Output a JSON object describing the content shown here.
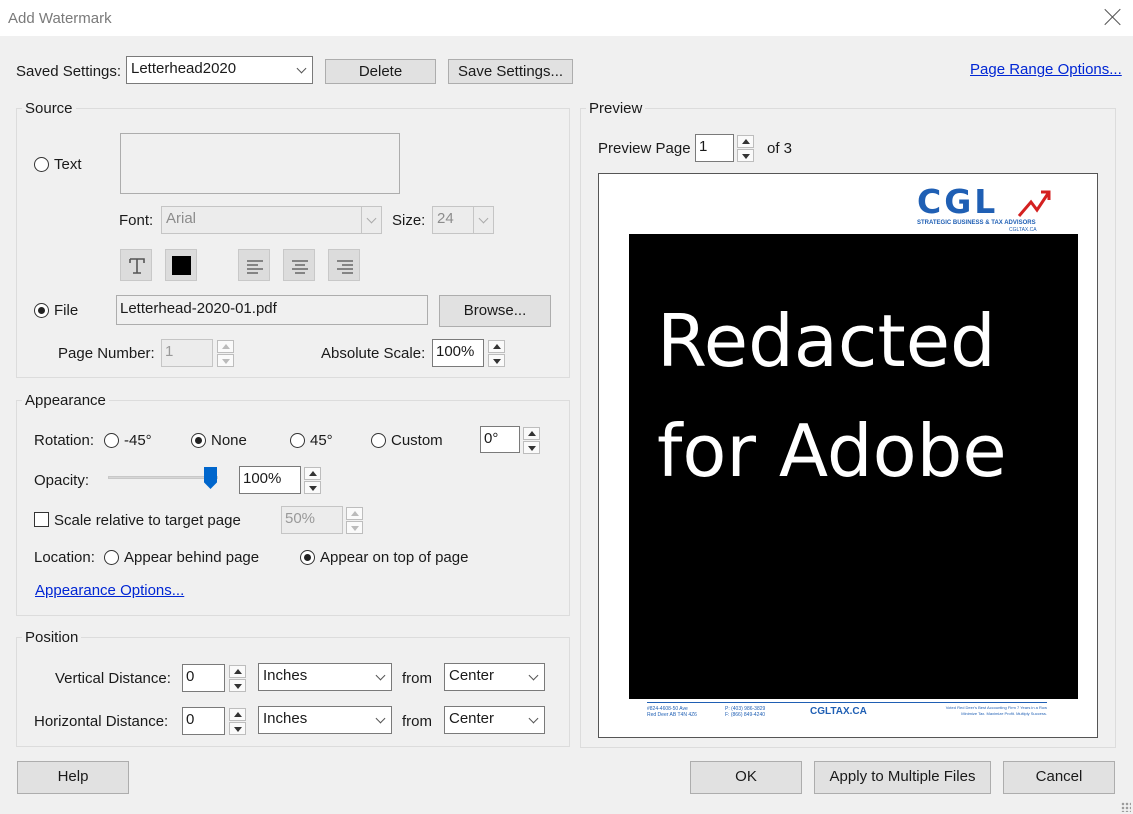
{
  "window": {
    "title": "Add Watermark"
  },
  "top": {
    "saved_settings_label": "Saved Settings:",
    "saved_settings_value": "Letterhead2020",
    "delete_label": "Delete",
    "save_settings_label": "Save Settings...",
    "page_range_link": "Page Range Options..."
  },
  "source": {
    "title": "Source",
    "text_label": "Text",
    "text_selected": false,
    "font_label": "Font:",
    "font_value": "Arial",
    "size_label": "Size:",
    "size_value": "24",
    "file_label": "File",
    "file_selected": true,
    "file_value": "Letterhead-2020-01.pdf",
    "browse_label": "Browse...",
    "page_number_label": "Page Number:",
    "page_number_value": "1",
    "absolute_scale_label": "Absolute Scale:",
    "absolute_scale_value": "100%"
  },
  "appearance": {
    "title": "Appearance",
    "rotation_label": "Rotation:",
    "rot_neg45": "-45°",
    "rot_none": "None",
    "rot_45": "45°",
    "rot_custom": "Custom",
    "rotation_selected": "None",
    "custom_value": "0°",
    "opacity_label": "Opacity:",
    "opacity_value": "100%",
    "opacity_level": 1.0,
    "scale_label": "Scale relative to target page",
    "scale_checked": false,
    "scale_value": "50%",
    "location_label": "Location:",
    "behind_label": "Appear behind page",
    "ontop_label": "Appear on top of page",
    "location_selected": "Appear on top of page",
    "options_link": "Appearance Options..."
  },
  "position": {
    "title": "Position",
    "vertical_label": "Vertical Distance:",
    "vertical_value": "0",
    "vertical_unit": "Inches",
    "horizontal_label": "Horizontal Distance:",
    "horizontal_value": "0",
    "horizontal_unit": "Inches",
    "from_label": "from",
    "vertical_from": "Center",
    "horizontal_from": "Center"
  },
  "preview": {
    "title": "Preview",
    "page_label": "Preview Page",
    "page_value": "1",
    "of_label": "of 3",
    "logo_text": "CGL",
    "logo_tagline": "STRATEGIC BUSINESS & TAX ADVISORS",
    "logo_site_small": "CGLTAX.CA",
    "redacted_line1": "Redacted",
    "redacted_line2": "for Adobe",
    "footer_site": "CGLTAX.CA",
    "footer_left1": "#824-4608-50 Ave",
    "footer_left2": "Red Deer  AB  T4N 4Z6",
    "footer_mid1": "P: (403) 986-3829",
    "footer_mid2": "F: (866) 849-4240",
    "footer_right1": "Voted Red Deer's Best Accounting Firm 7 Years in a Row",
    "footer_right2": "Minimize Tax. Maximize Profit. Multiply Success."
  },
  "buttons": {
    "help": "Help",
    "ok": "OK",
    "apply_multiple": "Apply to Multiple Files",
    "cancel": "Cancel"
  },
  "colors": {
    "link": "#0026d4",
    "accent": "#0066cc",
    "logo_blue": "#1f5fb4",
    "logo_red": "#d42020"
  }
}
